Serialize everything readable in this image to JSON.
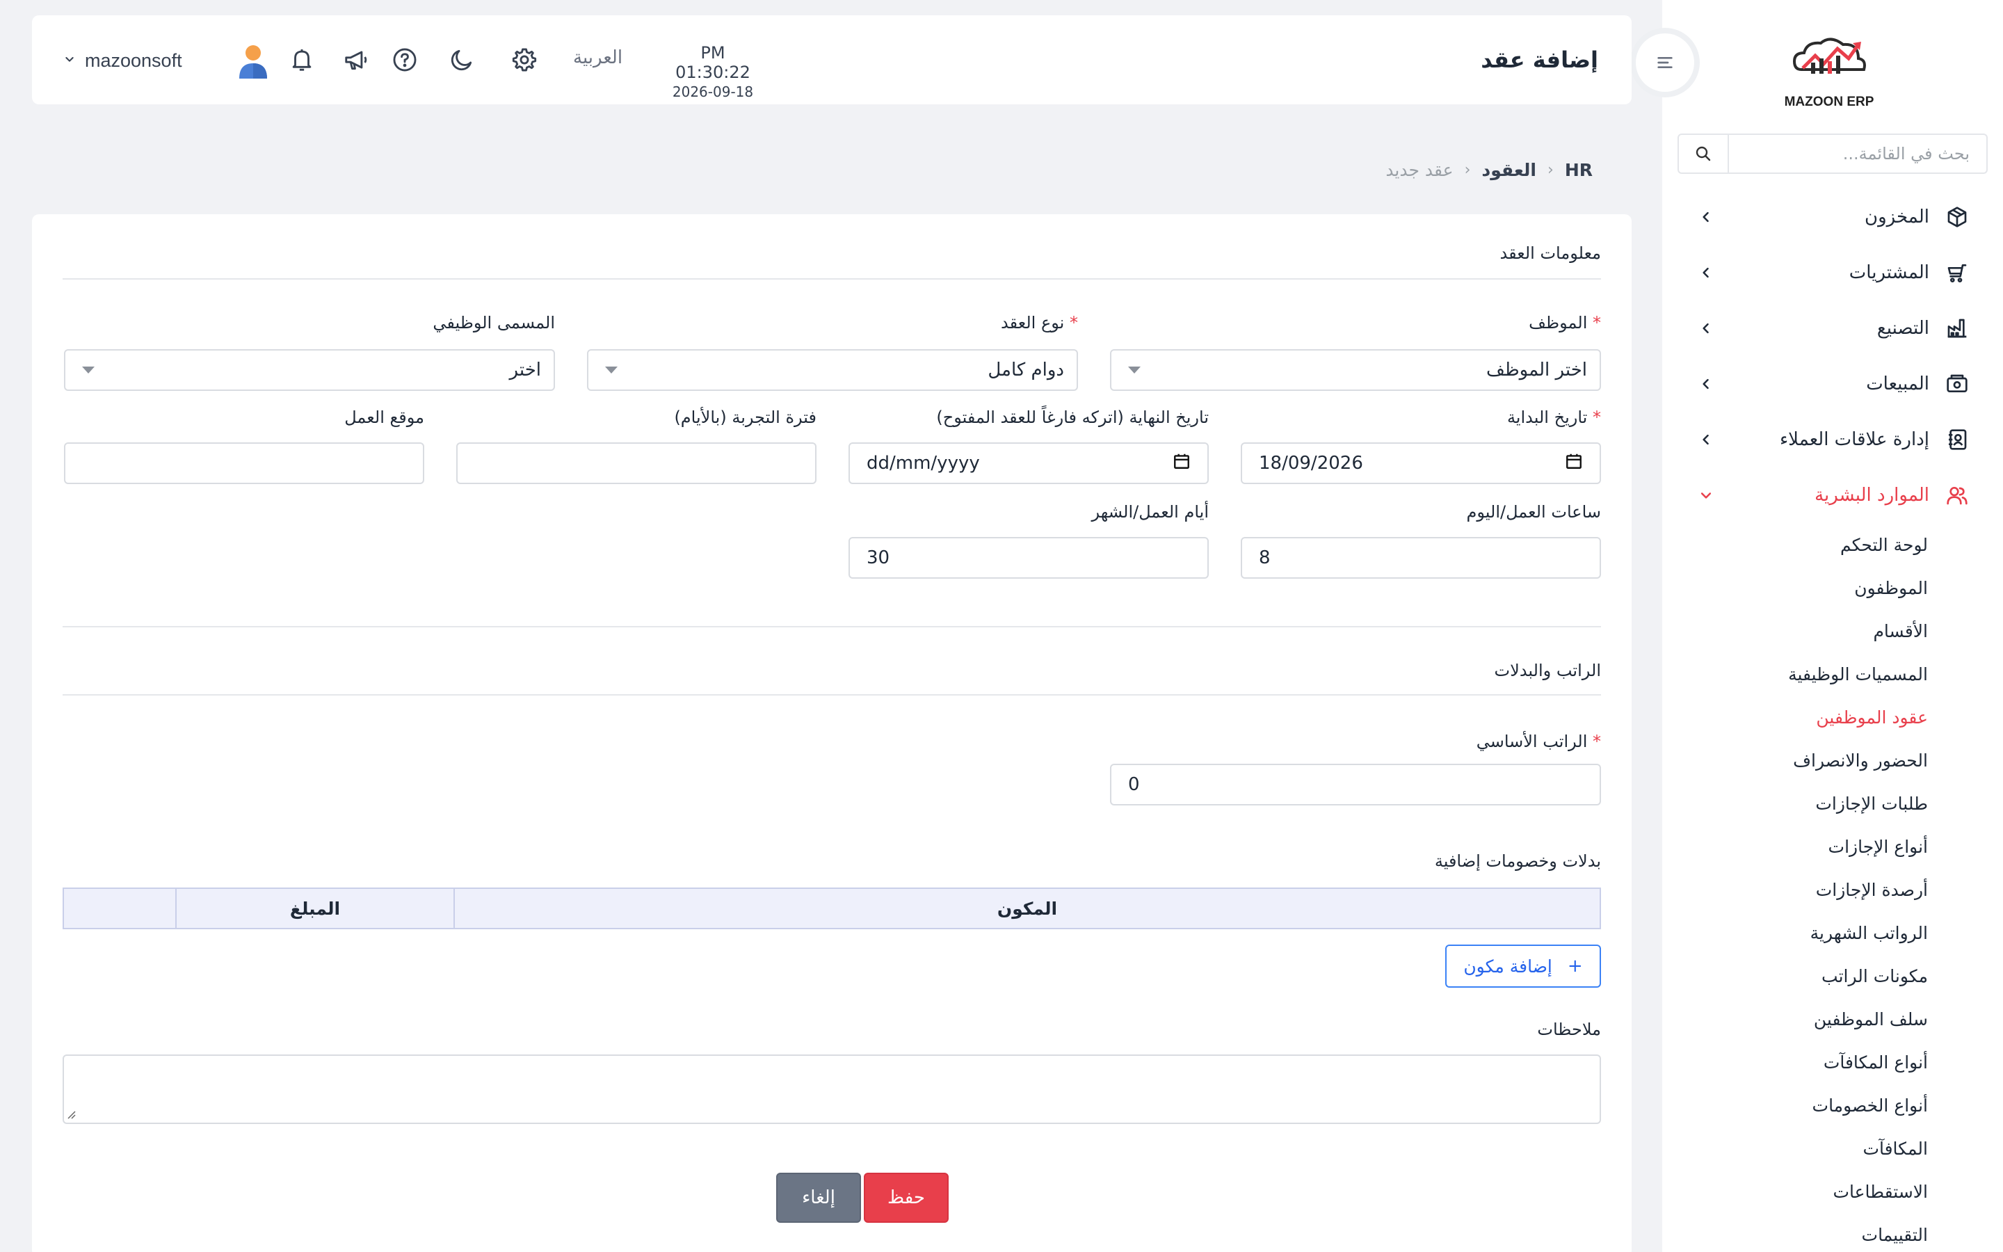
{
  "sidebar": {
    "logo_text": "MAZOON ERP",
    "search_placeholder": "بحث في القائمة...",
    "items": [
      {
        "label": "المخزون",
        "icon": "box-icon"
      },
      {
        "label": "المشتريات",
        "icon": "cart-icon"
      },
      {
        "label": "التصنيع",
        "icon": "factory-icon"
      },
      {
        "label": "المبيعات",
        "icon": "cash-register-icon"
      },
      {
        "label": "إدارة علاقات العملاء",
        "icon": "contacts-icon"
      },
      {
        "label": "الموارد البشرية",
        "icon": "users-icon"
      }
    ],
    "hr_subitems": [
      "لوحة التحكم",
      "الموظفون",
      "الأقسام",
      "المسميات الوظيفية",
      "عقود الموظفين",
      "الحضور والانصراف",
      "طلبات الإجازات",
      "أنواع الإجازات",
      "أرصدة الإجازات",
      "الرواتب الشهرية",
      "مكونات الراتب",
      "سلف الموظفين",
      "أنواع المكافآت",
      "أنواع الخصومات",
      "المكافآت",
      "الاستقطاعات",
      "التقييمات"
    ]
  },
  "header": {
    "title": "إضافة عقد",
    "time": "PM 01:30:22",
    "date": "2026-09-18",
    "language": "العربية",
    "username": "mazoonsoft"
  },
  "breadcrumb": {
    "root": "HR",
    "parent": "العقود",
    "current": "عقد جديد"
  },
  "form": {
    "contract_section": "معلومات العقد",
    "employee_label": "الموظف",
    "employee_value": "اختر الموظف",
    "contract_type_label": "نوع العقد",
    "contract_type_value": "دوام كامل",
    "job_title_label": "المسمى الوظيفي",
    "job_title_value": "اختر",
    "start_date_label": "تاريخ البداية",
    "start_date_value": "18/09/2026",
    "end_date_label": "تاريخ النهاية (اتركه فارغاً للعقد المفتوح)",
    "end_date_value": "dd/mm/yyyy",
    "probation_label": "فترة التجربة (بالأيام)",
    "work_location_label": "موقع العمل",
    "hours_label": "ساعات العمل/اليوم",
    "hours_value": "8",
    "days_label": "أيام العمل/الشهر",
    "days_value": "30",
    "salary_section": "الراتب والبدلات",
    "basic_salary_label": "الراتب الأساسي",
    "basic_salary_value": "0",
    "allowances_title": "بدلات وخصومات إضافية",
    "table_headers": {
      "component": "المكون",
      "amount": "المبلغ"
    },
    "add_component": "إضافة مكون",
    "notes_label": "ملاحظات",
    "save": "حفظ",
    "cancel": "إلغاء"
  },
  "colors": {
    "accent": "#e83f4b",
    "primary": "#3b82f6"
  }
}
